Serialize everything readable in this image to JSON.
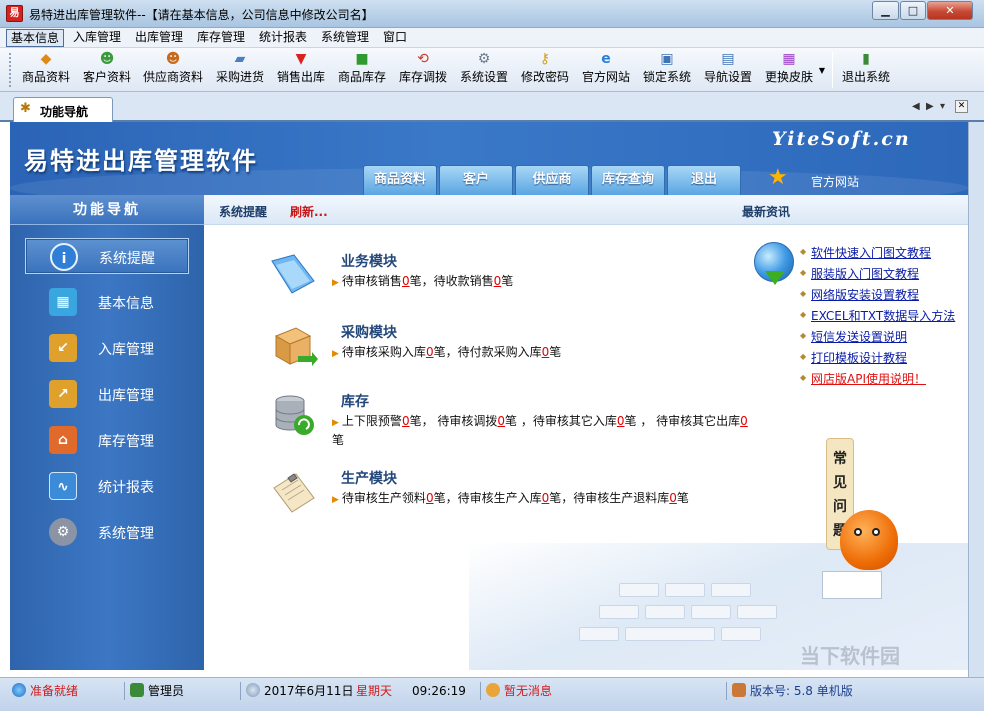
{
  "window": {
    "title": "易特进出库管理软件--【请在基本信息，公司信息中修改公司名】",
    "app_icon_glyph": "易",
    "min_glyph": "▁",
    "max_glyph": "□",
    "close_glyph": "✕"
  },
  "menu": {
    "items": [
      {
        "label": "基本信息"
      },
      {
        "label": "入库管理"
      },
      {
        "label": "出库管理"
      },
      {
        "label": "库存管理"
      },
      {
        "label": "统计报表"
      },
      {
        "label": "系统管理"
      },
      {
        "label": "窗口"
      }
    ]
  },
  "toolbar": {
    "items": [
      {
        "label": "商品资料",
        "icon": "product-icon"
      },
      {
        "label": "客户资料",
        "icon": "customers-icon"
      },
      {
        "label": "供应商资料",
        "icon": "supplier-icon"
      },
      {
        "label": "采购进货",
        "icon": "truck-icon"
      },
      {
        "label": "销售出库",
        "icon": "basket-icon"
      },
      {
        "label": "商品库存",
        "icon": "box-icon"
      },
      {
        "label": "库存调拨",
        "icon": "transfer-icon"
      },
      {
        "label": "系统设置",
        "icon": "settings-icon"
      },
      {
        "label": "修改密码",
        "icon": "key-icon"
      },
      {
        "label": "官方网站",
        "icon": "ie-icon"
      },
      {
        "label": "锁定系统",
        "icon": "lock-icon"
      },
      {
        "label": "导航设置",
        "icon": "nav-settings-icon"
      },
      {
        "label": "更换皮肤",
        "icon": "skin-icon"
      },
      {
        "label": "退出系统",
        "icon": "exit-icon"
      }
    ]
  },
  "tabs": {
    "active_label": "功能导航"
  },
  "banner": {
    "title": "易特进出库管理软件",
    "brand": "YiteSoft.cn",
    "tabs": [
      {
        "label": "商品资料"
      },
      {
        "label": "客户"
      },
      {
        "label": "供应商"
      },
      {
        "label": "库存查询"
      },
      {
        "label": "退出"
      }
    ],
    "site_link": "官方网站"
  },
  "leftnav": {
    "header": "功能导航",
    "items": [
      {
        "label": "系统提醒",
        "icon": "info-icon",
        "color": "#2f7fd6"
      },
      {
        "label": "基本信息",
        "icon": "cubes-icon",
        "color": "#39a6e0"
      },
      {
        "label": "入库管理",
        "icon": "box-in-icon",
        "color": "#e0a02c"
      },
      {
        "label": "出库管理",
        "icon": "box-out-icon",
        "color": "#e0a02c"
      },
      {
        "label": "库存管理",
        "icon": "warehouse-icon",
        "color": "#e06a2c"
      },
      {
        "label": "统计报表",
        "icon": "chart-icon",
        "color": "#3b8bd8"
      },
      {
        "label": "系统管理",
        "icon": "gears-icon",
        "color": "#8a94a4"
      }
    ]
  },
  "content": {
    "header_title": "系统提醒",
    "refresh_label": "刷新...",
    "news_title": "最新资讯",
    "modules": [
      {
        "title": "业务模块",
        "icon": "folder-icon",
        "parts": [
          "待审核销售",
          "0",
          "笔，待收款销售",
          "0",
          "笔"
        ]
      },
      {
        "title": "采购模块",
        "icon": "box-arrow-icon",
        "parts": [
          "待审核采购入库",
          "0",
          "笔，待付款采购入库",
          "0",
          "笔"
        ]
      },
      {
        "title": "库存",
        "icon": "database-icon",
        "parts": [
          "上下限预警",
          "0",
          "笔， 待审核调拨",
          "0",
          "笔 ，待审核其它入库",
          "0",
          "笔 ， 待审核其它出库",
          "0",
          "笔"
        ]
      },
      {
        "title": "生产模块",
        "icon": "clipboard-icon",
        "parts": [
          "待审核生产领料",
          "0",
          "笔，待审核生产入库",
          "0",
          "笔，待审核生产退料库",
          "0",
          "笔"
        ]
      }
    ],
    "news": [
      {
        "label": "软件快速入门图文教程",
        "color": "#0a1ca6"
      },
      {
        "label": "服装版入门图文教程",
        "color": "#0a1ca6"
      },
      {
        "label": "网络版安装设置教程",
        "color": "#0a1ca6"
      },
      {
        "label": "EXCEL和TXT数据导入方法",
        "color": "#0a1ca6"
      },
      {
        "label": "短信发送设置说明",
        "color": "#0a1ca6"
      },
      {
        "label": "打印模板设计教程",
        "color": "#0a1ca6"
      },
      {
        "label": "网店版API使用说明！",
        "color": "#e01010"
      }
    ],
    "faq_text": "常见问题"
  },
  "statusbar": {
    "status": "准备就绪",
    "user": "管理员",
    "date": "2017年6月11日",
    "weekday": "星期天",
    "time": "09:26:19",
    "messages": "暂无消息",
    "version": "版本号: 5.8 单机版"
  },
  "watermark": "当下软件园"
}
